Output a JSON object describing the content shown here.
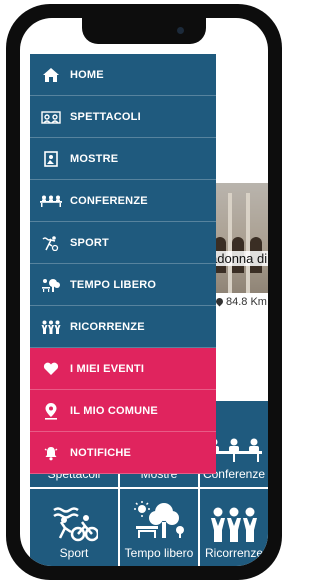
{
  "drawer": {
    "items": [
      {
        "label": "HOME",
        "icon": "home-icon"
      },
      {
        "label": "SPETTACOLI",
        "icon": "theater-icon"
      },
      {
        "label": "MOSTRE",
        "icon": "painting-icon"
      },
      {
        "label": "CONFERENZE",
        "icon": "conference-icon"
      },
      {
        "label": "SPORT",
        "icon": "runner-icon"
      },
      {
        "label": "TEMPO LIBERO",
        "icon": "leisure-icon"
      },
      {
        "label": "RICORRENZE",
        "icon": "people-icon"
      },
      {
        "label": "I MIEI EVENTI",
        "icon": "heart-icon"
      },
      {
        "label": "IL MIO COMUNE",
        "icon": "location-pin-icon"
      },
      {
        "label": "NOTIFICHE",
        "icon": "bell-icon"
      }
    ]
  },
  "background": {
    "event_caption": "adonna di",
    "distance": "84.8 Km",
    "tiles": [
      {
        "label": "Spettacoli"
      },
      {
        "label": "Mostre"
      },
      {
        "label": "Conferenze"
      },
      {
        "label": "Sport"
      },
      {
        "label": "Tempo libero"
      },
      {
        "label": "Ricorrenze"
      }
    ]
  },
  "colors": {
    "menu_blue": "#1f5a7e",
    "accent_pink": "#e0245e"
  }
}
